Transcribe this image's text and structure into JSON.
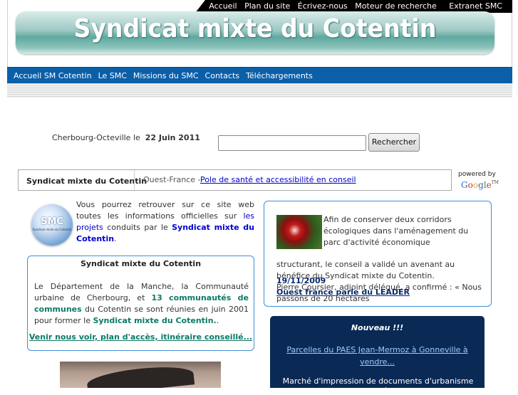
{
  "top_nav": {
    "links": [
      "Accueil",
      "Plan du site",
      "Écrivez-nous",
      "Moteur de recherche",
      "Extranet SMC"
    ]
  },
  "header": {
    "title": "Syndicat mixte du Cotentin"
  },
  "main_nav": {
    "items": [
      "Accueil SM Cotentin",
      "Le SMC",
      "Missions du SMC",
      "Contacts",
      "Téléchargements"
    ]
  },
  "date_line": {
    "prefix": "Cherbourg-Octeville le",
    "date": "22 Juin 2011"
  },
  "search": {
    "button_label": "Rechercher",
    "value": ""
  },
  "ticker": {
    "label": "Syndicat mixte du Cotentin",
    "source": "Ouest-France -",
    "headline": "Pole de santé et accessibilité en conseil",
    "powered_by": "powered by",
    "brand": "Google"
  },
  "logo": {
    "text": "SMC",
    "subtext": "Syndicat mixte du Cotentin"
  },
  "intro": {
    "part1": "Vous pourrez retrouver sur ce site web toutes les informations officielles sur",
    "link1": "les projets",
    "part2": "conduits par le",
    "link2": "Syndicat mixte du Cotentin",
    "end": "."
  },
  "left_box": {
    "title": "Syndicat mixte du Cotentin",
    "body_part1": "Le Département de la Manche, la Communauté urbaine de Cherbourg, et",
    "body_link1": "13 communautés de communes",
    "body_part2": "du Cotentin se sont réunies en juin 2001 pour former le",
    "body_link2": "Syndicat mixte du Cotentin.",
    "body_end": ".",
    "link": "Venir nous voir, plan d'accès, itinéraire conseillé..."
  },
  "right_panel": {
    "text1": "Afin de conserver deux corridors écologiques dans l'aménagement du parc d'activité économique",
    "text2": "structurant, le conseil a validé un avenant au bénéfice du Syndicat mixte du Cotentin.",
    "text3": "Pierre Coursier, adjoint délégué, a confirmé : « Nous passons de 20 hectares",
    "date": "19/11/2009",
    "news_title": "Ouest france parle du LEADER"
  },
  "news_box": {
    "title": "Nouveau !!!",
    "link": "Parcelles du PAES Jean-Mermoz à Gonneville à vendre...",
    "text": "Marché d'impression de documents d'urbanisme pour le"
  },
  "colors": {
    "nav_blue": "#0b5fa8",
    "box_border": "#3e8fd6",
    "dark_box": "#0a2a55",
    "banner_teal": "#5fa9a0"
  }
}
